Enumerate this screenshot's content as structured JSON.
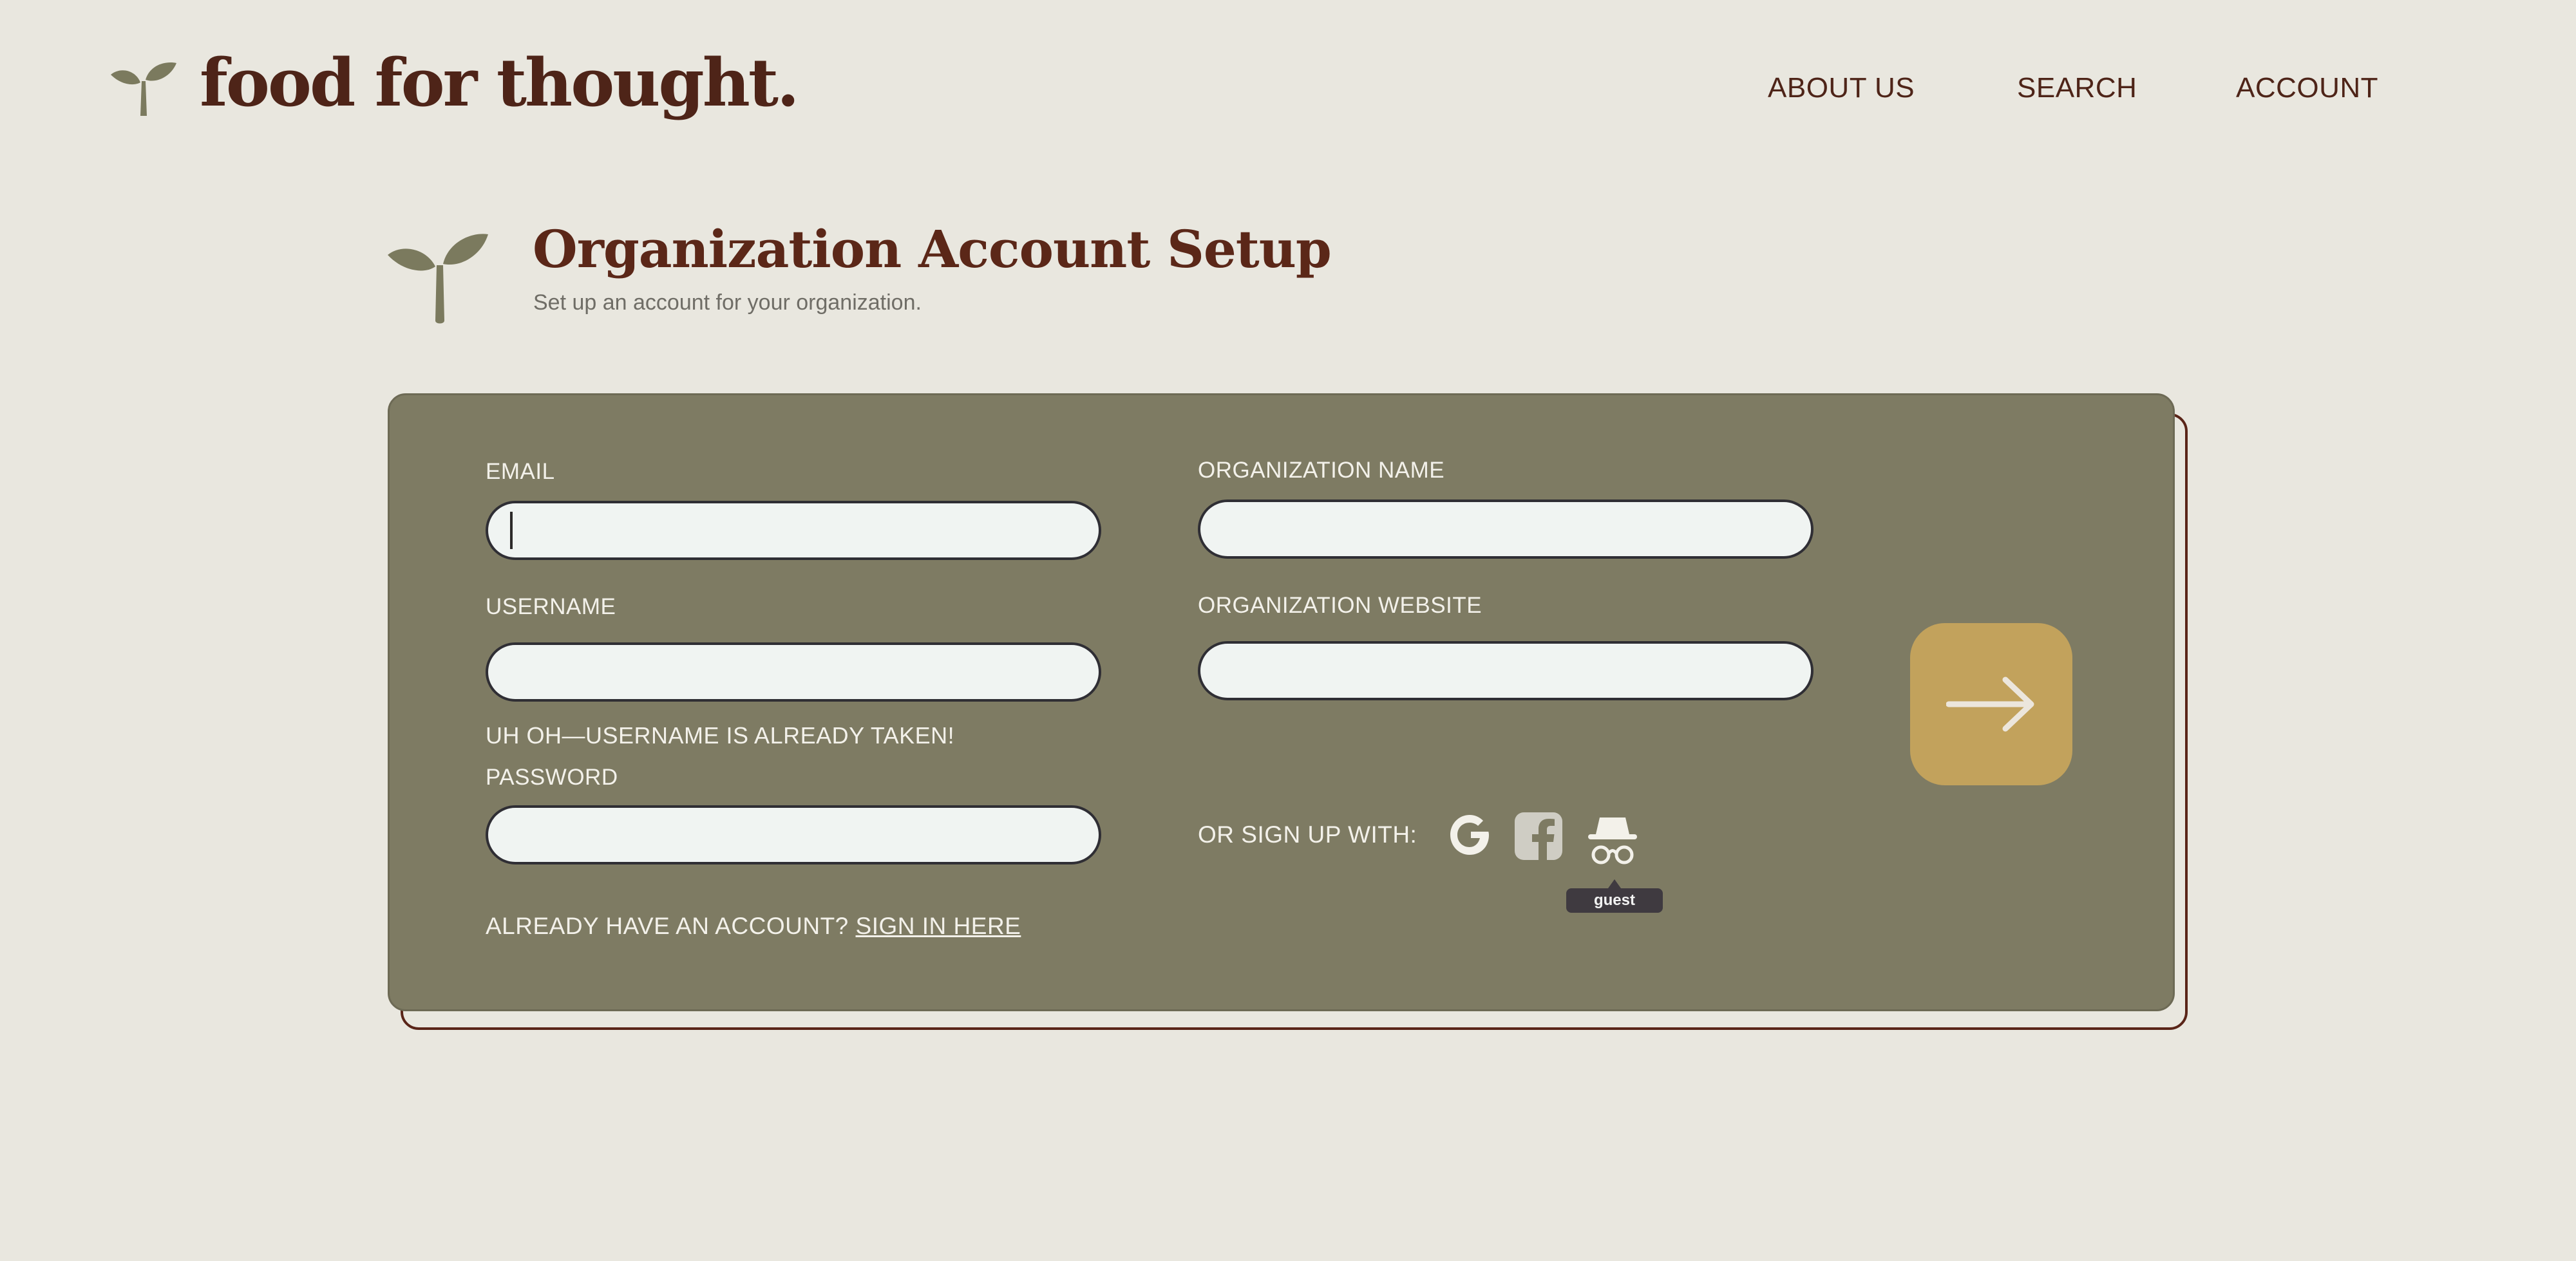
{
  "header": {
    "brand": "food for thought.",
    "nav": {
      "about": "ABOUT US",
      "search": "SEARCH",
      "account": "ACCOUNT"
    }
  },
  "page": {
    "title": "Organization Account Setup",
    "subtitle": "Set up an account for your organization."
  },
  "form": {
    "email_label": "EMAIL",
    "email_value": "",
    "username_label": "USERNAME",
    "username_value": "",
    "username_error": "UH OH—USERNAME IS ALREADY TAKEN!",
    "password_label": "PASSWORD",
    "password_value": "",
    "org_name_label": "ORGANIZATION NAME",
    "org_name_value": "",
    "org_website_label": "ORGANIZATION WEBSITE",
    "org_website_value": "",
    "signin_prompt": "ALREADY HAVE AN ACCOUNT?",
    "signin_link": "SIGN IN HERE",
    "social_label": "OR SIGN UP WITH:",
    "social_icons": [
      "google-icon",
      "facebook-icon",
      "guest-incognito-icon"
    ],
    "tooltip": "guest",
    "submit_icon": "arrow-right-icon"
  },
  "colors": {
    "background": "#e9e7df",
    "brand_brown": "#4e2418",
    "card_olive": "#7e7b63",
    "submit_gold": "#c2a25c",
    "sprout_olive": "#7b7a5e"
  }
}
